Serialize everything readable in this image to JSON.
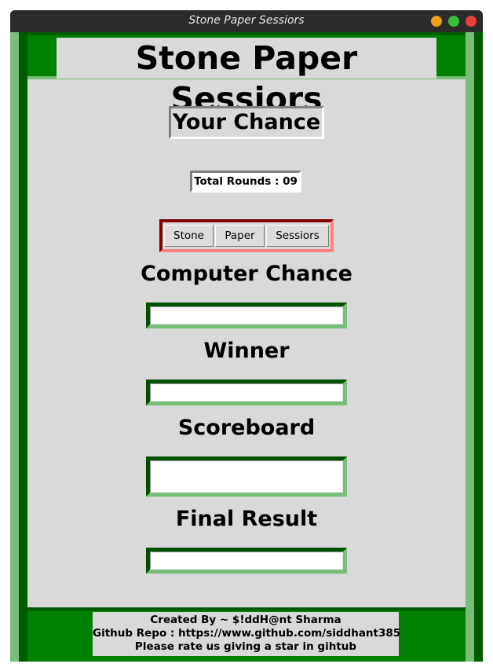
{
  "window": {
    "title": "Stone Paper Sessiors"
  },
  "header": {
    "title": "Stone Paper Sessiors"
  },
  "your_chance": {
    "label": "Your Chance"
  },
  "rounds": {
    "text": "Total Rounds : 09"
  },
  "choices": {
    "stone": "Stone",
    "paper": "Paper",
    "sessiors": "Sessiors"
  },
  "computer_chance": {
    "label": "Computer Chance",
    "value": ""
  },
  "winner": {
    "label": "Winner",
    "value": ""
  },
  "scoreboard": {
    "label": "Scoreboard",
    "value": ""
  },
  "final_result": {
    "label": "Final Result",
    "value": ""
  },
  "footer": {
    "line1": "Created By ~ $!ddH@nt Sharma",
    "line2": "Github Repo : https://www.github.com/siddhant385",
    "line3": "Please rate us giving a star in gihtub"
  },
  "colors": {
    "frame_green": "#008000",
    "dark_green": "#005000",
    "light_green": "#78bd78",
    "background": "#d9d9d9",
    "button_frame_dark": "#800000",
    "button_frame_light": "#ff8080"
  }
}
